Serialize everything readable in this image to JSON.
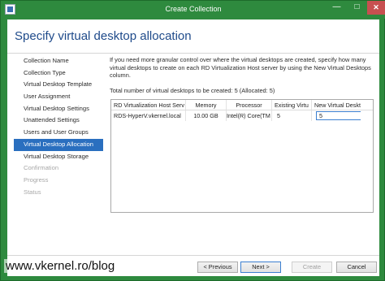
{
  "window": {
    "title": "Create Collection",
    "minimize_glyph": "—",
    "maximize_glyph": "□",
    "close_glyph": "✕"
  },
  "page": {
    "title": "Specify virtual desktop allocation"
  },
  "nav": {
    "items": [
      {
        "label": "Collection Name",
        "state": "normal"
      },
      {
        "label": "Collection Type",
        "state": "normal"
      },
      {
        "label": "Virtual Desktop Template",
        "state": "normal"
      },
      {
        "label": "User Assignment",
        "state": "normal"
      },
      {
        "label": "Virtual Desktop Settings",
        "state": "normal"
      },
      {
        "label": "Unattended Settings",
        "state": "normal"
      },
      {
        "label": "Users and User Groups",
        "state": "normal"
      },
      {
        "label": "Virtual Desktop Allocation",
        "state": "active"
      },
      {
        "label": "Virtual Desktop Storage",
        "state": "normal"
      },
      {
        "label": "Confirmation",
        "state": "disabled"
      },
      {
        "label": "Progress",
        "state": "disabled"
      },
      {
        "label": "Status",
        "state": "disabled"
      }
    ]
  },
  "content": {
    "description": "If you need more granular control over where the virtual desktops are created, specify how many virtual desktops to create on each RD Virtualization Host server by using the New Virtual Desktops column.",
    "total": "Total number of virtual desktops to be created: 5 (Allocated: 5)"
  },
  "grid": {
    "columns": [
      "RD Virtualization Host Serv",
      "Memory",
      "Processor",
      "Existing Virtu",
      "New Virtual Deskt"
    ],
    "rows": [
      {
        "server": "RDS-HyperV.vkernel.local",
        "memory": "10.00 GB",
        "processor": "Intel(R) Core(TM",
        "existing": "5",
        "new_value": "5"
      }
    ]
  },
  "buttons": {
    "previous": "< Previous",
    "next": "Next >",
    "create": "Create",
    "cancel": "Cancel"
  },
  "watermark": "www.vkernel.ro/blog",
  "colors": {
    "title_bar": "#2e8a3e",
    "accent": "#2a6fbf",
    "page_title": "#1e4a8a",
    "close_button": "#c75050"
  }
}
